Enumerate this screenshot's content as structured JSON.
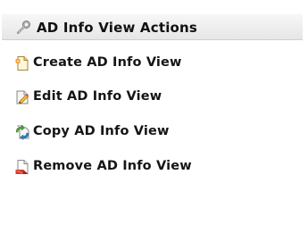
{
  "panel": {
    "title": "AD Info View Actions",
    "header_icon": "wrench-settings-icon",
    "items": [
      {
        "label": "Create AD Info View",
        "icon": "new-document-icon"
      },
      {
        "label": "Edit AD Info View",
        "icon": "edit-document-icon"
      },
      {
        "label": "Copy AD Info View",
        "icon": "copy-document-icon"
      },
      {
        "label": "Remove AD Info View",
        "icon": "remove-document-icon"
      }
    ]
  },
  "colors": {
    "header_gradient_top": "#f7f7f7",
    "header_gradient_bottom": "#e6e6e6",
    "text": "#151515",
    "accent_green": "#54a842",
    "accent_blue": "#2f86c6",
    "accent_red": "#d83c2f",
    "accent_orange": "#f2a23a"
  }
}
